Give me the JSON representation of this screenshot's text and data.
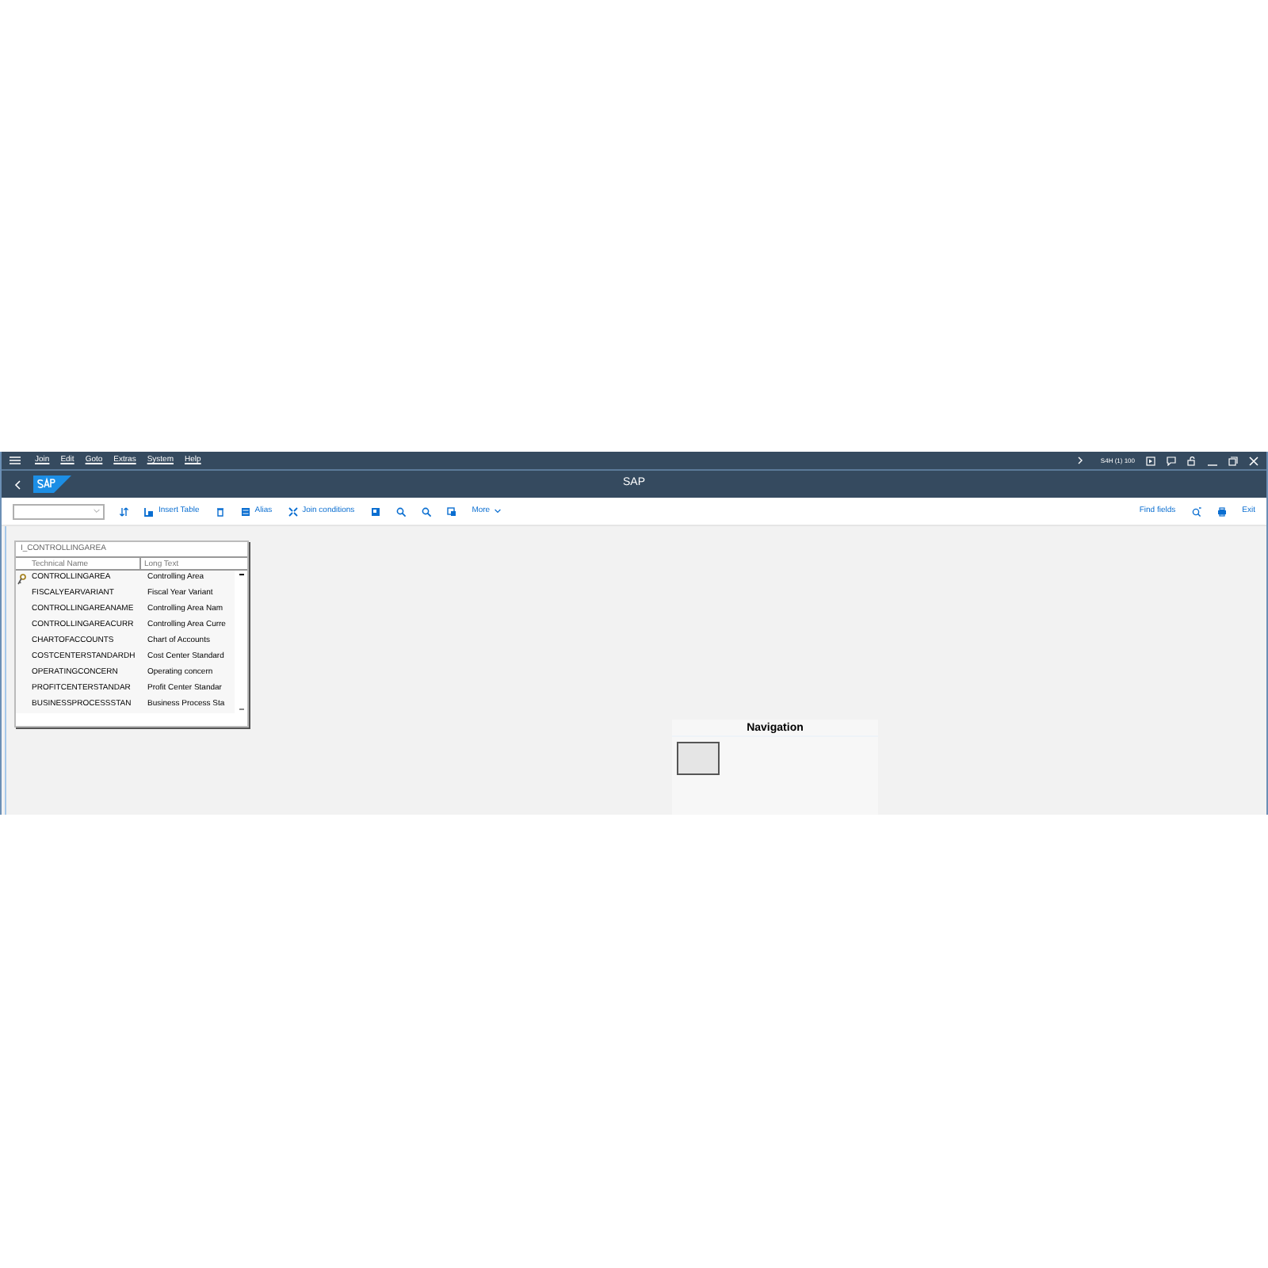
{
  "menu": [
    "Join",
    "Edit",
    "Goto",
    "Extras",
    "System",
    "Help"
  ],
  "system_info": "S4H (1) 100",
  "title": "SAP",
  "toolbar": {
    "left": [
      {
        "kind": "icon"
      },
      {
        "kind": "button",
        "label": "Insert Table"
      },
      {
        "kind": "icon"
      },
      {
        "kind": "button",
        "label": "Alias"
      },
      {
        "kind": "button",
        "label": "Join conditions"
      },
      {
        "kind": "icon"
      },
      {
        "kind": "icon"
      },
      {
        "kind": "icon"
      },
      {
        "kind": "icon"
      },
      {
        "kind": "menu",
        "label": "More"
      }
    ],
    "right": [
      {
        "kind": "button",
        "label": "Find fields"
      },
      {
        "kind": "icon"
      },
      {
        "kind": "icon"
      },
      {
        "kind": "button",
        "label": "Exit"
      }
    ]
  },
  "table": {
    "name": "I_CONTROLLINGAREA",
    "columns": [
      "Technical Name",
      "Long Text"
    ],
    "rows": [
      {
        "technical_name": "CONTROLLINGAREA",
        "long_text": "Controlling Area",
        "key": true
      },
      {
        "technical_name": "FISCALYEARVARIANT",
        "long_text": "Fiscal Year Variant",
        "key": false
      },
      {
        "technical_name": "CONTROLLINGAREANAME",
        "long_text": "Controlling Area Nam",
        "key": false
      },
      {
        "technical_name": "CONTROLLINGAREACURR",
        "long_text": "Controlling Area Curre",
        "key": false
      },
      {
        "technical_name": "CHARTOFACCOUNTS",
        "long_text": "Chart of Accounts",
        "key": false
      },
      {
        "technical_name": "COSTCENTERSTANDARDH",
        "long_text": "Cost Center Standard",
        "key": false
      },
      {
        "technical_name": "OPERATINGCONCERN",
        "long_text": "Operating concern",
        "key": false
      },
      {
        "technical_name": "PROFITCENTERSTANDAR",
        "long_text": "Profit Center Standar",
        "key": false
      },
      {
        "technical_name": "BUSINESSPROCESSSTAN",
        "long_text": "Business Process Sta",
        "key": false
      }
    ]
  },
  "navigation": {
    "title": "Navigation"
  }
}
